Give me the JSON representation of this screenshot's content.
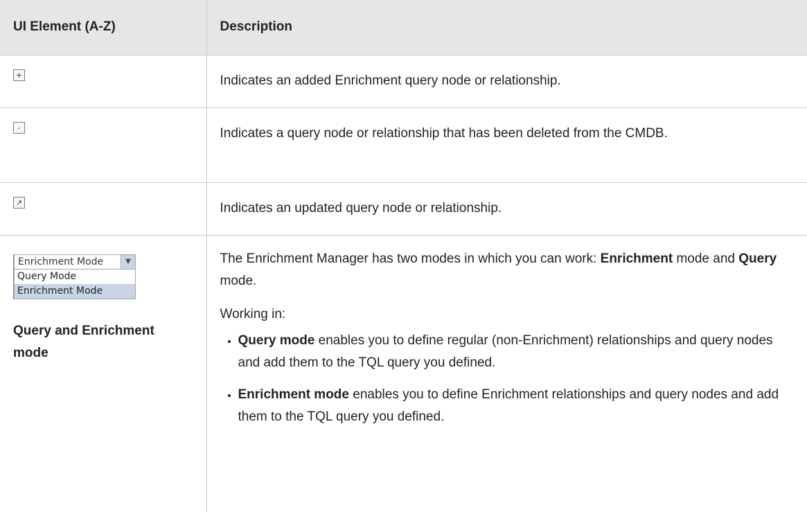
{
  "headers": [
    "UI Element (A-Z)",
    "Description"
  ],
  "rows": [
    {
      "icon": "+",
      "icon_name": "added-icon",
      "desc": "Indicates an added Enrichment query node or relationship."
    },
    {
      "icon": "-",
      "icon_name": "deleted-icon",
      "desc": "Indicates a query node or relationship that has been deleted from the CMDB."
    },
    {
      "icon": "↗",
      "icon_name": "updated-icon",
      "desc": "Indicates an updated query node or relationship."
    }
  ],
  "mode_row": {
    "dropdown": {
      "selected": "Enrichment Mode",
      "options": [
        "Query Mode",
        "Enrichment Mode"
      ]
    },
    "title": "Query and Enrichment mode",
    "intro_pre": "The Enrichment Manager has two modes in which you can work: ",
    "intro_bold1": "Enrichment",
    "intro_mid": " mode and ",
    "intro_bold2": "Query",
    "intro_post": " mode.",
    "working_in": "Working in:",
    "bullets": [
      {
        "bold": "Query mode",
        "text": " enables you to define regular (non-Enrichment) relationships and query nodes and add them to the TQL query you defined."
      },
      {
        "bold": "Enrichment mode",
        "text": " enables you to define Enrichment relationships and query nodes and add them to the TQL query you defined."
      }
    ]
  }
}
